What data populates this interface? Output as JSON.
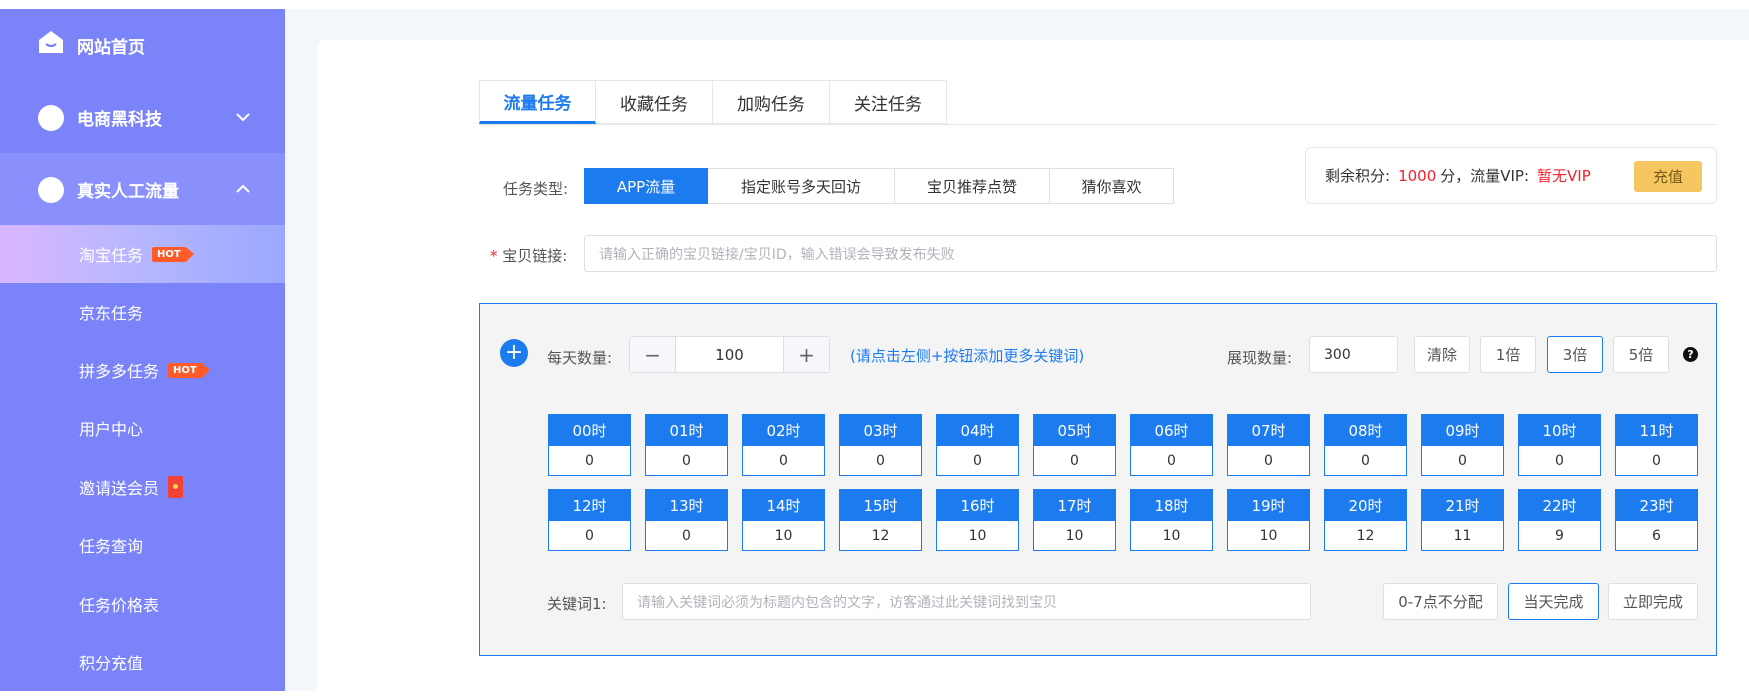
{
  "sidebar": {
    "home": "网站首页",
    "ecom": "电商黑科技",
    "traffic": "真实人工流量",
    "hot_badge": "HOT",
    "sub_items": [
      "淘宝任务",
      "京东任务",
      "拼多多任务",
      "用户中心",
      "邀请送会员",
      "任务查询",
      "任务价格表",
      "积分充值"
    ]
  },
  "tabs": [
    "流量任务",
    "收藏任务",
    "加购任务",
    "关注任务"
  ],
  "task_type": {
    "label": "任务类型:",
    "options": [
      "APP流量",
      "指定账号多天回访",
      "宝贝推荐点赞",
      "猜你喜欢"
    ]
  },
  "balance": {
    "label": "剩余积分:",
    "value": "1000",
    "unit": "分，流量VIP:",
    "vip": "暂无VIP",
    "recharge": "充值"
  },
  "link": {
    "required_mark": "*",
    "label": "宝贝链接:",
    "placeholder": "请输入正确的宝贝链接/宝贝ID，输入错误会导致发布失败"
  },
  "panel": {
    "plus": "+",
    "daily_label": "每天数量:",
    "minus": "−",
    "daily_value": "100",
    "plus_small": "+",
    "hint": "(请点击左侧+按钮添加更多关键词)",
    "show_label": "展现数量:",
    "show_value": "300",
    "clear": "清除",
    "x1": "1倍",
    "x3": "3倍",
    "x5": "5倍",
    "help": "?",
    "hours": [
      {
        "h": "00时",
        "v": "0"
      },
      {
        "h": "01时",
        "v": "0"
      },
      {
        "h": "02时",
        "v": "0"
      },
      {
        "h": "03时",
        "v": "0"
      },
      {
        "h": "04时",
        "v": "0"
      },
      {
        "h": "05时",
        "v": "0"
      },
      {
        "h": "06时",
        "v": "0"
      },
      {
        "h": "07时",
        "v": "0"
      },
      {
        "h": "08时",
        "v": "0"
      },
      {
        "h": "09时",
        "v": "0"
      },
      {
        "h": "10时",
        "v": "0"
      },
      {
        "h": "11时",
        "v": "0"
      },
      {
        "h": "12时",
        "v": "0"
      },
      {
        "h": "13时",
        "v": "0"
      },
      {
        "h": "14时",
        "v": "10"
      },
      {
        "h": "15时",
        "v": "12"
      },
      {
        "h": "16时",
        "v": "10"
      },
      {
        "h": "17时",
        "v": "10"
      },
      {
        "h": "18时",
        "v": "10"
      },
      {
        "h": "19时",
        "v": "10"
      },
      {
        "h": "20时",
        "v": "12"
      },
      {
        "h": "21时",
        "v": "11"
      },
      {
        "h": "22时",
        "v": "9"
      },
      {
        "h": "23时",
        "v": "6"
      }
    ],
    "keyword_label": "关键词1:",
    "keyword_placeholder": "请输入关键词必须为标题内包含的文字，访客通过此关键词找到宝贝",
    "no_dist": "0-7点不分配",
    "same_day": "当天完成",
    "immediate": "立即完成"
  }
}
